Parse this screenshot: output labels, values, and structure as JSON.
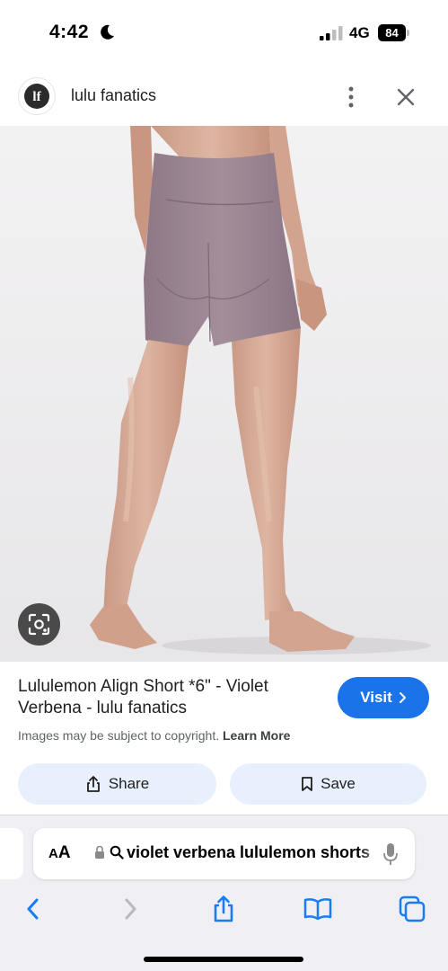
{
  "status_bar": {
    "time": "4:42",
    "network": "4G",
    "battery": "84"
  },
  "header": {
    "logo_text": "lf",
    "site_name": "lulu fanatics"
  },
  "result": {
    "title": "Lululemon Align Short *6\" - Violet Verbena - lulu fanatics",
    "visit_label": "Visit",
    "copyright_notice": "Images may be subject to copyright.",
    "learn_more_label": "Learn More"
  },
  "actions": {
    "share_label": "Share",
    "save_label": "Save"
  },
  "browser": {
    "aa_small": "A",
    "aa_big": "A",
    "address_text": "violet verbena lululemon shorts"
  },
  "colors": {
    "accent": "#1a73e8",
    "action_bg": "#e8f0fe",
    "ios_blue": "#1a7cf5",
    "shorts": "#9b8592"
  },
  "icons": {
    "moon": "moon-icon",
    "signal": "signal-icon",
    "more": "more-vert-icon",
    "close": "close-icon",
    "lens": "lens-icon",
    "share": "share-icon",
    "save": "bookmark-icon",
    "lock": "lock-icon",
    "search": "search-icon",
    "mic": "mic-icon",
    "back": "chevron-left-icon",
    "forward": "chevron-right-icon",
    "browser_share": "share-icon",
    "bookmarks": "book-icon",
    "tabs": "tabs-icon"
  }
}
